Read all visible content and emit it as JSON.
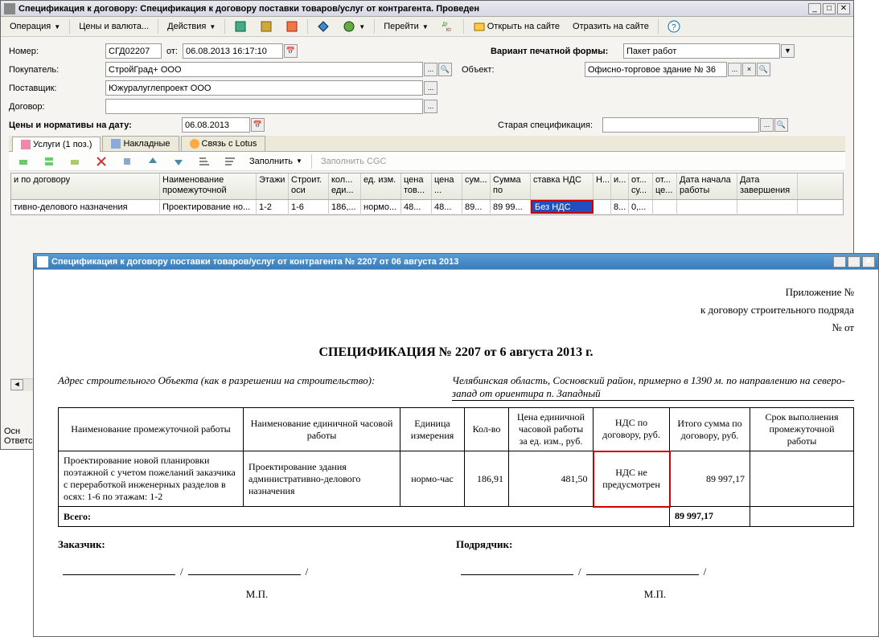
{
  "win1": {
    "title": "Спецификация к договору: Спецификация к договору поставки товаров/услуг от контрагента. Проведен",
    "toolbar": {
      "operation": "Операция",
      "prices": "Цены и валюта...",
      "actions": "Действия",
      "goto": "Перейти",
      "open_site": "Открыть на сайте",
      "reflect_site": "Отразить на сайте"
    },
    "form": {
      "number_lbl": "Номер:",
      "number": "СГД02207",
      "from_lbl": "от:",
      "date": "06.08.2013 16:17:10",
      "variant_lbl": "Вариант печатной формы:",
      "variant": "Пакет работ",
      "buyer_lbl": "Покупатель:",
      "buyer": "СтройГрад+ ООО",
      "object_lbl": "Объект:",
      "object": "Офисно-торговое здание № 36",
      "supplier_lbl": "Поставщик:",
      "supplier": "Южуралуглепроект ООО",
      "contract_lbl": "Договор:",
      "contract": "",
      "prices_date_lbl": "Цены и нормативы на дату:",
      "prices_date": "06.08.2013",
      "old_spec_lbl": "Старая спецификация:",
      "old_spec": ""
    },
    "tabs": {
      "services": "Услуги (1 поз.)",
      "invoices": "Накладные",
      "lotus": "Связь с Lotus"
    },
    "subtoolbar": {
      "fill": "Заполнить",
      "fill_cgc": "Заполнить CGC"
    },
    "grid": {
      "headers": [
        "и по договору",
        "Наименование промежуточной",
        "Этажи",
        "Строит. оси",
        "кол... еди...",
        "ед. изм.",
        "цена тов...",
        "цена ...",
        "сум...",
        "Сумма по",
        "ставка НДС",
        "Н...",
        "и...",
        "от... су...",
        "от... це...",
        "Дата начала работы",
        "Дата завершения"
      ],
      "row": [
        "тивно-делового назначения",
        "Проектирование но...",
        "1-2",
        "1-6",
        "186,...",
        "нормо...",
        "48...",
        "48...",
        "89...",
        "89 99...",
        "Без НДС",
        "",
        "8...",
        "0,...",
        "",
        "",
        ""
      ]
    },
    "bottom": {
      "basis": "Осн",
      "resp": "Ответс"
    }
  },
  "win2": {
    "title": "Спецификация к договору поставки товаров/услуг от контрагента № 2207 от 06 августа 2013",
    "doc": {
      "app": "Приложение №",
      "to_contract": "к договору строительного подряда",
      "num_from": "№ от",
      "title": "СПЕЦИФИКАЦИЯ № 2207 от 6 августа 2013 г.",
      "addr_lbl": "Адрес строительного Объекта (как в разрешении на строительство):",
      "addr_val": "Челябинская область, Сосновский район, примерно в 1390 м. по направлению на северо-запад от ориентира п. Западный",
      "th": [
        "Наименование промежуточной работы",
        "Наименование единичной часовой работы",
        "Единица измерения",
        "Кол-во",
        "Цена единичной часовой работы за ед. изм., руб.",
        "НДС по договору, руб.",
        "Итого сумма по договору, руб.",
        "Срок выполнения промежуточной работы"
      ],
      "td": [
        "Проектирование новой планировки поэтажной с учетом пожеланий заказчика с переработкой инженерных разделов в осях: 1-6 по этажам: 1-2",
        "Проектирование здания административно-делового назначения",
        "нормо-час",
        "186,91",
        "481,50",
        "НДС не предусмотрен",
        "89 997,17",
        ""
      ],
      "total_lbl": "Всего:",
      "total_val": "89 997,17",
      "customer": "Заказчик:",
      "contractor": "Подрядчик:",
      "stamp": "М.П."
    }
  }
}
